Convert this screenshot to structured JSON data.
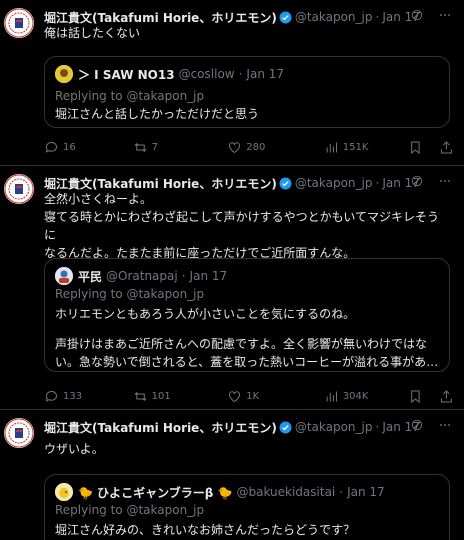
{
  "colors": {
    "background": "#000000",
    "text": "#e7e9ea",
    "muted": "#71767b",
    "border": "#2f3336",
    "verified": "#1d9bf0"
  },
  "tweets": [
    {
      "author_name": "堀江貴文(Takafumi Horie、ホリエモン)",
      "handle": "@takapon_jp",
      "dot": "·",
      "date": "Jan 17",
      "text_lines": [
        "俺は話したくない"
      ],
      "quote": {
        "author_name": "＞ I SAW NO13",
        "handle": "@cosllow",
        "dot": "·",
        "date": "Jan 17",
        "replying": "Replying to @takapon_jp",
        "text_lines": [
          "堀江さんと話したかっただけだと思う"
        ]
      },
      "stats": {
        "replies": "16",
        "retweets": "7",
        "likes": "280",
        "views": "151K"
      }
    },
    {
      "author_name": "堀江貴文(Takafumi Horie、ホリエモン)",
      "handle": "@takapon_jp",
      "dot": "·",
      "date": "Jan 17",
      "text_lines": [
        "全然小さくねーよ。",
        "寝てる時とかにわざわざ起こして声かけするやつとかもいてマジキレそうに",
        "なるんだよ。たまたま前に座っただけでご近所面すんな。"
      ],
      "quote": {
        "author_name": "平民",
        "handle": "@Oratnapaj",
        "dot": "·",
        "date": "Jan 17",
        "replying": "Replying to @takapon_jp",
        "text_lines": [
          "ホリエモンともあろう人が小さいことを気にするのね。",
          "",
          "声掛けはまあご近所さんへの配慮ですよ。全く影響が無いわけではな",
          "い。急な勢いで倒されると、蓋を取った熱いコーヒーが溢れる事があ…"
        ]
      },
      "stats": {
        "replies": "133",
        "retweets": "101",
        "likes": "1K",
        "views": "304K"
      }
    },
    {
      "author_name": "堀江貴文(Takafumi Horie、ホリエモン)",
      "handle": "@takapon_jp",
      "dot": "·",
      "date": "Jan 17",
      "text_lines": [
        "ウザいよ。"
      ],
      "quote": {
        "author_name": "🐤 ひよこギャンブラーβ 🐤",
        "handle": "@bakuekidasitai",
        "dot": "·",
        "date": "Jan 17",
        "replying": "Replying to @takapon_jp",
        "text_lines": [
          "堀江さん好みの、きれいなお姉さんだったらどうです？"
        ]
      }
    }
  ]
}
